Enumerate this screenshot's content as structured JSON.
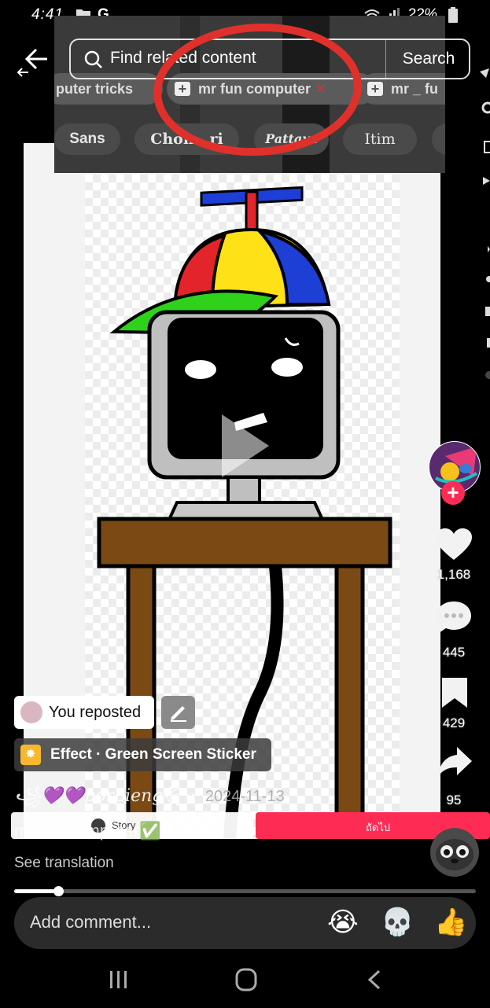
{
  "status_bar": {
    "time": "4:41",
    "carrier_icon": "G",
    "battery": "22%"
  },
  "overlay": {
    "search": {
      "placeholder": "Find related content",
      "button": "Search"
    },
    "chips_row1": [
      "puter tricks",
      "mr fun computer",
      "mr _ fu"
    ],
    "chips_row2": [
      "Sans",
      "Chon...ri",
      "Pattaya",
      "Itim"
    ]
  },
  "right_rail": {
    "likes": "1,168",
    "comments": "445",
    "saves": "429",
    "shares": "95"
  },
  "left_captions": {
    "reposted": "You reposted",
    "effect": "Effect · Green Screen Sticker",
    "author_line": "꧁💜💜porpieng꧂·",
    "date": "2024-11-13",
    "story_label": "Story",
    "next_label": "ถัดไป",
    "caption": "mr.fun computer✅",
    "see_translation": "See translation"
  },
  "progress": {
    "fraction": 0.095
  },
  "comment_bar": {
    "placeholder": "Add comment...",
    "emojis": [
      "😭",
      "💀",
      "👍"
    ]
  },
  "colors": {
    "accent_red": "#fe2c55",
    "circle_red": "#e0302b",
    "effect_yellow": "#f5b82e"
  },
  "icons": [
    "back-arrow-icon",
    "search-icon",
    "heart-icon",
    "comment-icon",
    "bookmark-icon",
    "share-icon",
    "play-icon",
    "edit-icon",
    "recents-icon",
    "home-icon",
    "back-nav-icon"
  ]
}
